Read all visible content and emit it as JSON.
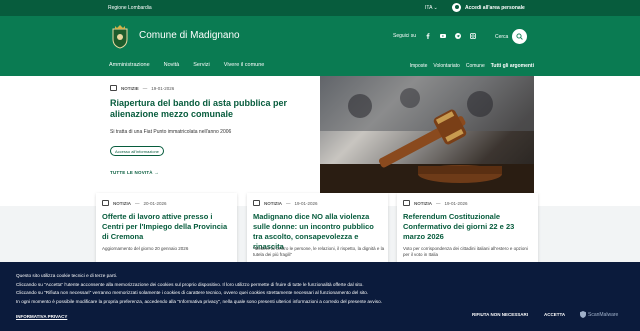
{
  "topbar": {
    "region": "Regione Lombardia",
    "lang": "ITA",
    "login": "Accedi all'area personale"
  },
  "header": {
    "title": "Comune di Madignano",
    "follow_label": "Seguici su",
    "search_label": "Cerca",
    "main_nav": [
      "Amministrazione",
      "Novità",
      "Servizi",
      "Vivere il comune"
    ],
    "sub_nav": [
      "Imposte",
      "Volontariato",
      "Comune",
      "Tutti gli argomenti"
    ]
  },
  "hero": {
    "category": "NOTIZIE",
    "date": "19-01-2026",
    "title": "Riapertura del bando di asta pubblica per alienazione mezzo comunale",
    "description": "Si tratta di una Fiat Punto immatricolata nell'anno 2006",
    "tag": "Accesso all'informazione",
    "all_news": "TUTTE LE NOVITÀ"
  },
  "cards": [
    {
      "category": "NOTIZIA",
      "date": "20-01-2026",
      "title": "Offerte di lavoro attive presso i Centri per l'Impiego della Provincia di Cremona",
      "text": "Aggiornamento del giorno 20 gennaio 2026"
    },
    {
      "category": "NOTIZIA",
      "date": "19-01-2026",
      "title": "Madignano dice NO alla violenza sulle donne: un incontro pubblico tra ascolto, consapevolezza e rinascita",
      "text": "\"Mettere al centro le persone, le relazioni, il rispetto, la dignità e la tutela dei più fragili\""
    },
    {
      "category": "NOTIZIA",
      "date": "19-01-2026",
      "title": "Referendum Costituzionale Confermativo dei giorni 22 e 23 marzo 2026",
      "text": "Voto per corrispondenza dei cittadini italiani all'estero e opzioni per il voto in Italia"
    }
  ],
  "cookie": {
    "lines": [
      "Questo sito utilizza cookie tecnici e di terze parti.",
      "Cliccando su \"Accetta\" l'utente acconsente alla memorizzazione dei cookies sul proprio dispositivo. Il loro utilizzo permette di fruire di tutte le funzionalità offerte dal sito.",
      "Cliccando su \"Rifiuta non necessari\" verranno memorizzati solamente i cookies di carattere tecnico, ovvero quei cookies strettamente necessari al funzionamento del sito.",
      "In ogni momento è possibile modificare la propria preferenza, accedendo alla \"Informativa privacy\", nella quale sono presenti ulteriori informazioni a corredo del presente avviso."
    ],
    "privacy": "INFORMATIVA PRIVACY",
    "reject": "RIFIUTA NON NECESSARI",
    "accept": "ACCETTA",
    "brand": "ScanMalware"
  },
  "colors": {
    "primary": "#0a7b52",
    "dark": "#075c3d",
    "cookie_bg": "#0b1b3c"
  }
}
